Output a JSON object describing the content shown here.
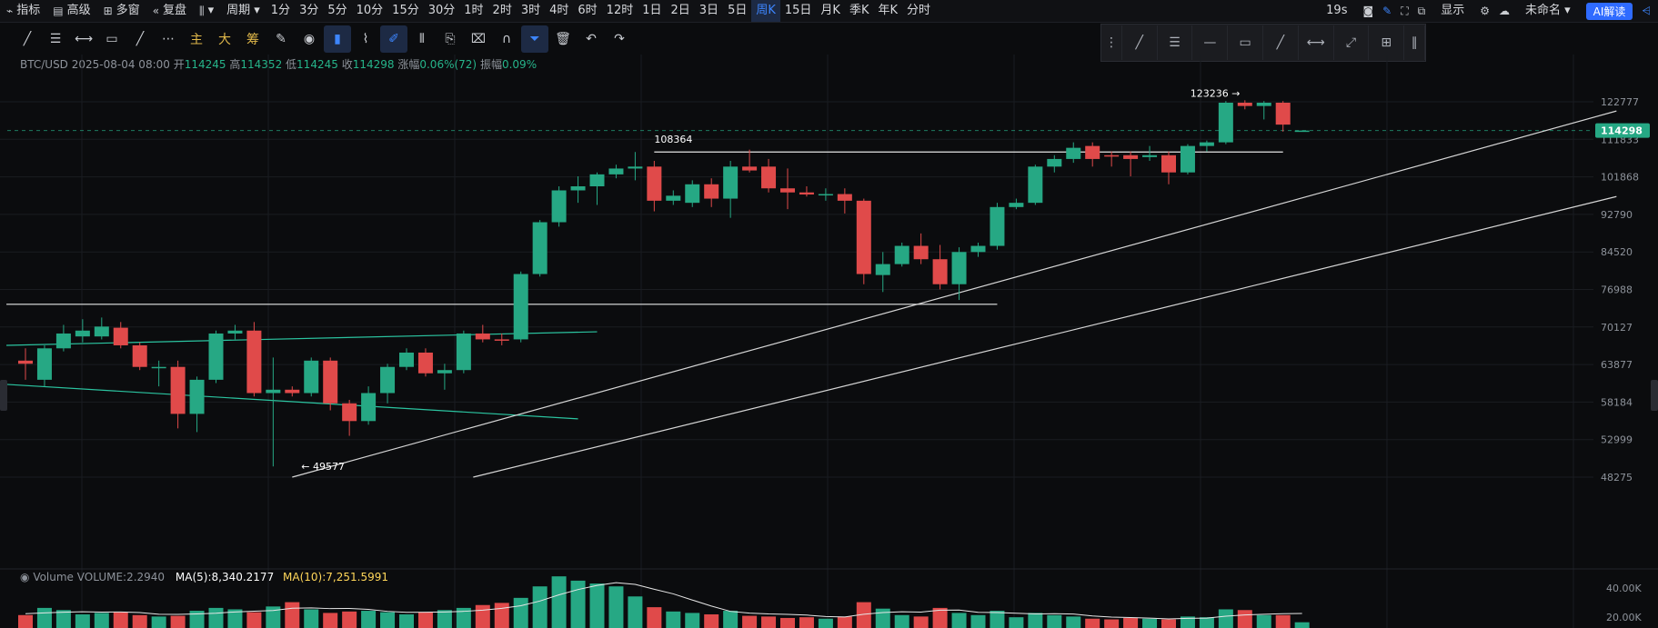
{
  "topbar": {
    "items": [
      {
        "icon": "indicator-icon",
        "glyph": "⌁",
        "label": "指标"
      },
      {
        "icon": "advanced-icon",
        "glyph": "▤",
        "label": "高级"
      },
      {
        "icon": "multiwindow-icon",
        "glyph": "⊞",
        "label": "多窗"
      },
      {
        "icon": "replay-icon",
        "glyph": "«",
        "label": "复盘"
      },
      {
        "icon": "charttype-icon",
        "glyph": "⫼",
        "label": "▾"
      },
      {
        "icon": "",
        "glyph": "",
        "label": "周期 ▾"
      }
    ],
    "periods": [
      "1分",
      "3分",
      "5分",
      "10分",
      "15分",
      "30分",
      "1时",
      "2时",
      "3时",
      "4时",
      "6时",
      "12时",
      "1日",
      "2日",
      "3日",
      "5日",
      "周K",
      "15日",
      "月K",
      "季K",
      "年K",
      "分时"
    ],
    "active_period": "周K",
    "right": {
      "timer": "19s",
      "display_label": "显示",
      "untitled_label": "未命名 ▾",
      "ai_label": "AI解读"
    }
  },
  "draw_toolbar": {
    "tools": [
      {
        "name": "trendline-tool",
        "glyph": "╱"
      },
      {
        "name": "hline-multi-tool",
        "glyph": "☰"
      },
      {
        "name": "hray-tool",
        "glyph": "⟷"
      },
      {
        "name": "rect-tool",
        "glyph": "▭"
      },
      {
        "name": "pen-tool",
        "glyph": "╱"
      },
      {
        "name": "more-tool",
        "glyph": "⋯"
      }
    ],
    "text_tools": [
      "主",
      "大",
      "筹"
    ],
    "tools2": [
      {
        "name": "edit-tool",
        "glyph": "✎"
      },
      {
        "name": "paint-tool",
        "glyph": "◉"
      },
      {
        "name": "bookmark-tool",
        "glyph": "▮",
        "active": true
      },
      {
        "name": "ruler-tool",
        "glyph": "⌇"
      },
      {
        "name": "brush-tool",
        "glyph": "✐",
        "active": true
      },
      {
        "name": "candle-tool",
        "glyph": "⫴"
      },
      {
        "name": "clipboard-tool",
        "glyph": "⎘"
      },
      {
        "name": "note-tool",
        "glyph": "⌧"
      },
      {
        "name": "magnet-tool",
        "glyph": "∩"
      },
      {
        "name": "filter-tool",
        "glyph": "⏷",
        "active": true
      },
      {
        "name": "trash-tool",
        "glyph": "🗑"
      },
      {
        "name": "undo-tool",
        "glyph": "↶"
      },
      {
        "name": "redo-tool",
        "glyph": "↷"
      }
    ],
    "float_tools": [
      "⋮",
      "╱",
      "☰",
      "—",
      "▭",
      "╱",
      "⟷",
      "⤢",
      "⊞",
      "∥"
    ]
  },
  "symbol_info": {
    "symbol": "BTC/USD",
    "datetime": "2025-08-04 08:00",
    "open_label": "开",
    "open": "114245",
    "high_label": "高",
    "high": "114352",
    "low_label": "低",
    "low": "114245",
    "close_label": "收",
    "close": "114298",
    "change_label": "涨幅",
    "change": "0.06%(72)",
    "amp_label": "振幅",
    "amp": "0.09%"
  },
  "volume_info": {
    "label": "Volume",
    "volume": "VOLUME:2.2940",
    "ma5": "MA(5):8,340.2177",
    "ma10": "MA(10):7,251.5991"
  },
  "colors": {
    "up": "#26a884",
    "down": "#e04a4a",
    "bg": "#0b0c0e",
    "grid": "#1a1c21",
    "price_tag": "#26a884"
  },
  "chart_data": {
    "type": "candlestick",
    "price_axis": [
      "122777",
      "114298",
      "111833",
      "101868",
      "92790",
      "84520",
      "76988",
      "70127",
      "63877",
      "58184",
      "52999",
      "48275"
    ],
    "price_axis_values": [
      122777,
      111833,
      101868,
      92790,
      84520,
      76988,
      70127,
      63877,
      58184,
      52999,
      48275
    ],
    "log_scale": true,
    "current_price": 114298,
    "annotations": [
      {
        "text": "123236",
        "value": 123236,
        "index": 64
      },
      {
        "text": "108364",
        "value": 108364,
        "index": 33
      },
      {
        "text": "49577",
        "value": 49577,
        "index": 14
      }
    ],
    "candles": [
      {
        "o": 64500,
        "h": 66500,
        "l": 61500,
        "c": 64000
      },
      {
        "o": 61500,
        "h": 67000,
        "l": 60500,
        "c": 66500
      },
      {
        "o": 66500,
        "h": 70500,
        "l": 66000,
        "c": 69000
      },
      {
        "o": 68500,
        "h": 71500,
        "l": 67500,
        "c": 69500
      },
      {
        "o": 68500,
        "h": 71800,
        "l": 68000,
        "c": 70200
      },
      {
        "o": 70000,
        "h": 71000,
        "l": 66500,
        "c": 67000
      },
      {
        "o": 67000,
        "h": 67500,
        "l": 63000,
        "c": 63500
      },
      {
        "o": 63500,
        "h": 64500,
        "l": 60500,
        "c": 63500
      },
      {
        "o": 63500,
        "h": 64500,
        "l": 54500,
        "c": 56500
      },
      {
        "o": 56500,
        "h": 62000,
        "l": 54000,
        "c": 61500
      },
      {
        "o": 61500,
        "h": 69500,
        "l": 61000,
        "c": 69000
      },
      {
        "o": 69000,
        "h": 70500,
        "l": 68000,
        "c": 69500
      },
      {
        "o": 69500,
        "h": 71000,
        "l": 59000,
        "c": 59500
      },
      {
        "o": 59500,
        "h": 65000,
        "l": 49577,
        "c": 60000
      },
      {
        "o": 60000,
        "h": 60500,
        "l": 59000,
        "c": 59500
      },
      {
        "o": 59500,
        "h": 65000,
        "l": 59000,
        "c": 64500
      },
      {
        "o": 64500,
        "h": 65000,
        "l": 57000,
        "c": 58000
      },
      {
        "o": 58000,
        "h": 58500,
        "l": 53500,
        "c": 55500
      },
      {
        "o": 55500,
        "h": 60500,
        "l": 55000,
        "c": 59500
      },
      {
        "o": 59500,
        "h": 64000,
        "l": 58000,
        "c": 63500
      },
      {
        "o": 63500,
        "h": 66500,
        "l": 63000,
        "c": 65800
      },
      {
        "o": 65800,
        "h": 66500,
        "l": 62000,
        "c": 62500
      },
      {
        "o": 62500,
        "h": 64000,
        "l": 60000,
        "c": 63000
      },
      {
        "o": 63000,
        "h": 69500,
        "l": 62500,
        "c": 69000
      },
      {
        "o": 69000,
        "h": 70500,
        "l": 67500,
        "c": 68000
      },
      {
        "o": 68000,
        "h": 69000,
        "l": 67000,
        "c": 67800
      },
      {
        "o": 68000,
        "h": 80500,
        "l": 67500,
        "c": 80000
      },
      {
        "o": 80000,
        "h": 91500,
        "l": 79500,
        "c": 91000
      },
      {
        "o": 91000,
        "h": 99500,
        "l": 90000,
        "c": 98500
      },
      {
        "o": 98500,
        "h": 102000,
        "l": 95500,
        "c": 99500
      },
      {
        "o": 99500,
        "h": 103000,
        "l": 95000,
        "c": 102500
      },
      {
        "o": 102500,
        "h": 105000,
        "l": 101500,
        "c": 104000
      },
      {
        "o": 104000,
        "h": 108364,
        "l": 101000,
        "c": 104500
      },
      {
        "o": 104500,
        "h": 106000,
        "l": 93500,
        "c": 96000
      },
      {
        "o": 96000,
        "h": 98500,
        "l": 95000,
        "c": 97200
      },
      {
        "o": 95500,
        "h": 101000,
        "l": 94500,
        "c": 100000
      },
      {
        "o": 100000,
        "h": 101500,
        "l": 94500,
        "c": 96500
      },
      {
        "o": 96500,
        "h": 106000,
        "l": 92000,
        "c": 104500
      },
      {
        "o": 104500,
        "h": 109000,
        "l": 103000,
        "c": 103500
      },
      {
        "o": 104500,
        "h": 106500,
        "l": 98000,
        "c": 99000
      },
      {
        "o": 99000,
        "h": 104000,
        "l": 94000,
        "c": 98000
      },
      {
        "o": 98000,
        "h": 99500,
        "l": 97000,
        "c": 97500
      },
      {
        "o": 97500,
        "h": 99000,
        "l": 96000,
        "c": 97600
      },
      {
        "o": 97600,
        "h": 99000,
        "l": 93000,
        "c": 96000
      },
      {
        "o": 96000,
        "h": 96500,
        "l": 78000,
        "c": 80000
      },
      {
        "o": 79800,
        "h": 84500,
        "l": 76500,
        "c": 82000
      },
      {
        "o": 82000,
        "h": 86500,
        "l": 81500,
        "c": 85800
      },
      {
        "o": 85800,
        "h": 88500,
        "l": 82000,
        "c": 83000
      },
      {
        "o": 83000,
        "h": 86000,
        "l": 77000,
        "c": 78000
      },
      {
        "o": 78000,
        "h": 85500,
        "l": 75000,
        "c": 84500
      },
      {
        "o": 84500,
        "h": 86500,
        "l": 83500,
        "c": 85800
      },
      {
        "o": 85800,
        "h": 95500,
        "l": 85000,
        "c": 94500
      },
      {
        "o": 94500,
        "h": 96500,
        "l": 94000,
        "c": 95500
      },
      {
        "o": 95500,
        "h": 105000,
        "l": 95000,
        "c": 104500
      },
      {
        "o": 104500,
        "h": 107500,
        "l": 103000,
        "c": 106500
      },
      {
        "o": 106500,
        "h": 111000,
        "l": 105500,
        "c": 109500
      },
      {
        "o": 110000,
        "h": 111000,
        "l": 104500,
        "c": 106500
      },
      {
        "o": 107500,
        "h": 108500,
        "l": 104500,
        "c": 107200
      },
      {
        "o": 107500,
        "h": 108500,
        "l": 102000,
        "c": 106500
      },
      {
        "o": 107000,
        "h": 110000,
        "l": 106000,
        "c": 107500
      },
      {
        "o": 107500,
        "h": 108500,
        "l": 100000,
        "c": 103000
      },
      {
        "o": 103000,
        "h": 110500,
        "l": 102500,
        "c": 110000
      },
      {
        "o": 110000,
        "h": 111500,
        "l": 108500,
        "c": 111000
      },
      {
        "o": 111000,
        "h": 123000,
        "l": 110500,
        "c": 122500
      },
      {
        "o": 122500,
        "h": 123236,
        "l": 120500,
        "c": 121500
      },
      {
        "o": 121500,
        "h": 123000,
        "l": 117500,
        "c": 122500
      },
      {
        "o": 122500,
        "h": 123000,
        "l": 114000,
        "c": 116000
      },
      {
        "o": 114245,
        "h": 114352,
        "l": 114245,
        "c": 114298
      }
    ],
    "volume_axis": [
      "40.00K",
      "20.00K"
    ],
    "volume_max": 47000,
    "volumes": [
      9000,
      14000,
      12500,
      9500,
      10500,
      11000,
      9000,
      8000,
      8500,
      12000,
      14000,
      13000,
      11000,
      15000,
      18000,
      13000,
      10500,
      11500,
      12000,
      11000,
      9500,
      11000,
      12500,
      14000,
      16000,
      17500,
      21000,
      29000,
      36000,
      33000,
      31000,
      29000,
      22000,
      14500,
      11500,
      10500,
      9500,
      12000,
      8500,
      8000,
      7000,
      7500,
      6500,
      8000,
      18000,
      13500,
      9000,
      8000,
      14000,
      10500,
      9000,
      12000,
      7500,
      10500,
      9000,
      8000,
      6500,
      6000,
      7000,
      6500,
      6000,
      8000,
      7500,
      13000,
      12500,
      9000,
      9000,
      4000
    ],
    "ma5_volume": [
      10000,
      10500,
      11000,
      11300,
      11100,
      11200,
      10800,
      9600,
      9500,
      9800,
      10300,
      11200,
      11700,
      12200,
      13800,
      14000,
      13500,
      13600,
      13000,
      11600,
      10900,
      11000,
      11200,
      11600,
      12400,
      13700,
      15500,
      18800,
      23100,
      26800,
      29700,
      31600,
      30400,
      27000,
      23800,
      19500,
      15300,
      11600,
      10400,
      9800,
      9500,
      9000,
      8000,
      7700,
      9600,
      10800,
      11300,
      11100,
      12400,
      12500,
      10900,
      10800,
      10300,
      9800,
      10000,
      9700,
      8400,
      7600,
      7300,
      6900,
      6300,
      6700,
      6900,
      8200,
      9100,
      9600,
      10000,
      10100
    ]
  },
  "drawings": {
    "channel_top": [
      {
        "i": -1,
        "p": 67000
      },
      {
        "i": 30,
        "p": 69300
      }
    ],
    "channel_bottom": [
      {
        "i": -1,
        "p": 60800
      },
      {
        "i": 29,
        "p": 55800
      }
    ],
    "support_line": [
      {
        "i": -1,
        "p": 74200
      },
      {
        "i": 51,
        "p": 74200
      }
    ],
    "resistance_line": [
      {
        "i": 33,
        "p": 108364
      },
      {
        "i": 66,
        "p": 108364
      }
    ],
    "trend_upper": [
      {
        "i": 14,
        "p": 48275
      },
      {
        "i": 83.5,
        "p": 120000
      }
    ],
    "trend_lower": [
      {
        "i": 23.5,
        "p": 48275
      },
      {
        "i": 83.5,
        "p": 97000
      }
    ]
  }
}
